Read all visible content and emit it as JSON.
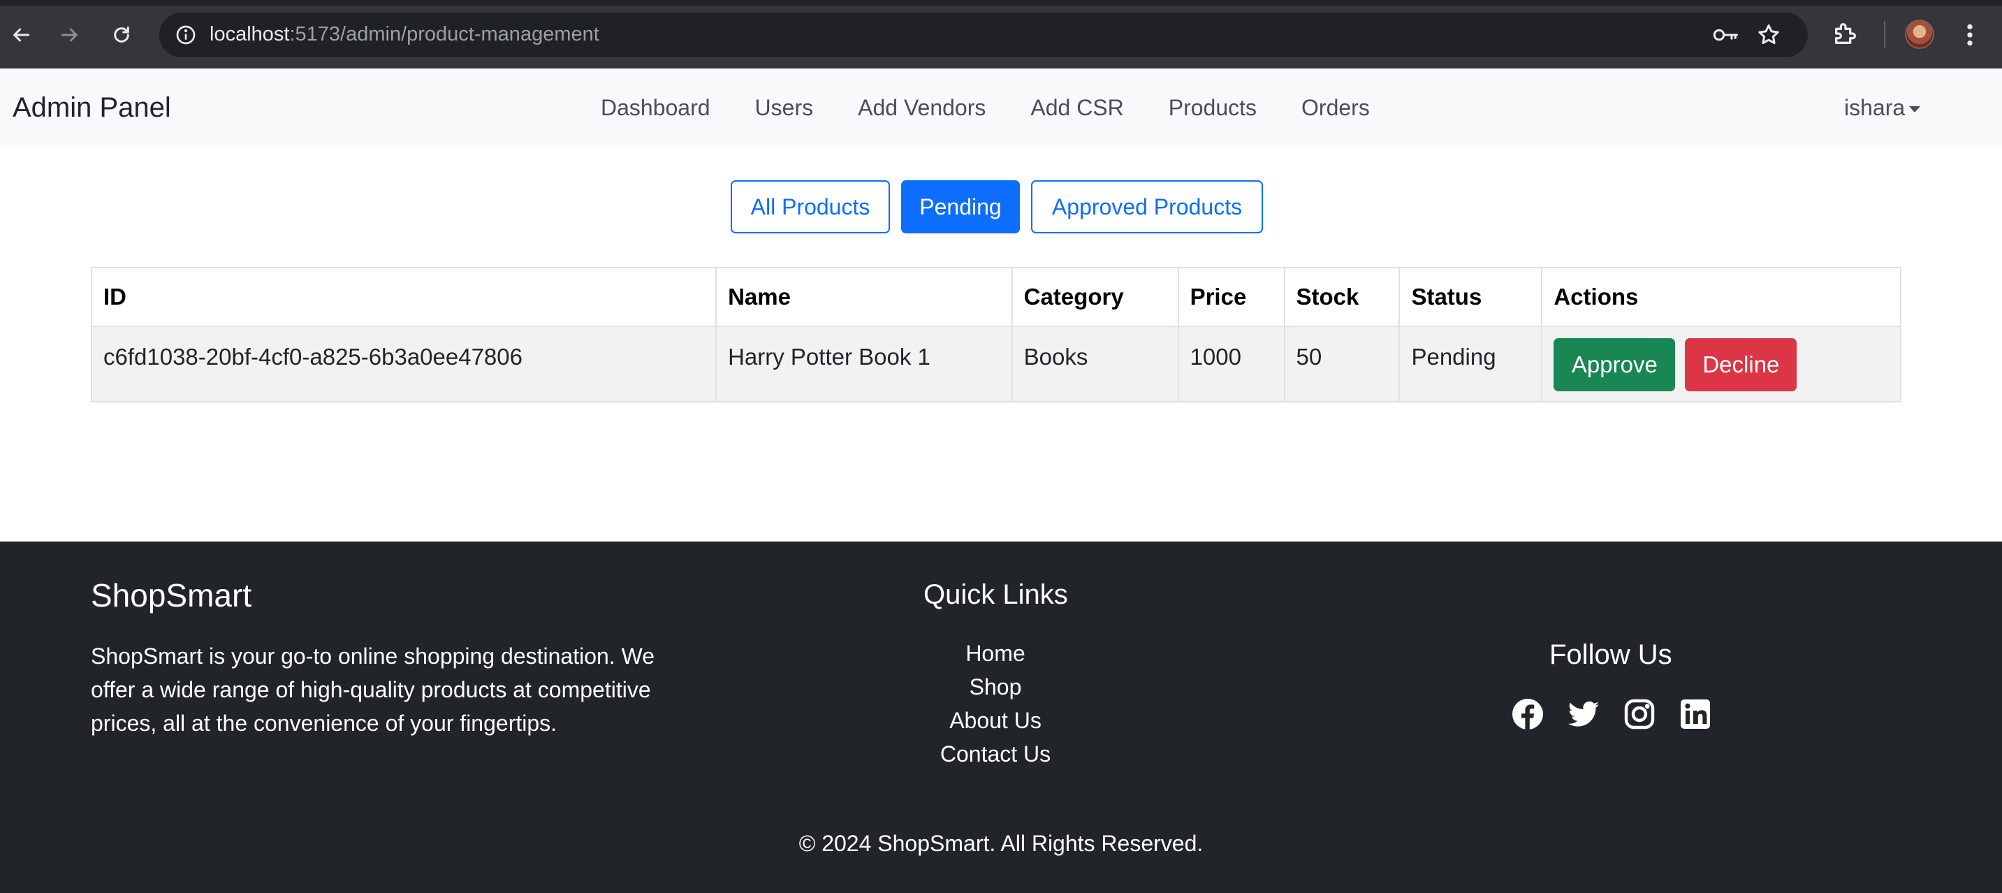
{
  "browser": {
    "url_host": "localhost",
    "url_path": ":5173/admin/product-management"
  },
  "navbar": {
    "brand": "Admin Panel",
    "links": [
      "Dashboard",
      "Users",
      "Add Vendors",
      "Add CSR",
      "Products",
      "Orders"
    ],
    "user": "ishara"
  },
  "filters": {
    "all": "All Products",
    "pending": "Pending",
    "approved": "Approved Products",
    "active": "Pending"
  },
  "table": {
    "headers": [
      "ID",
      "Name",
      "Category",
      "Price",
      "Stock",
      "Status",
      "Actions"
    ],
    "rows": [
      {
        "id": "c6fd1038-20bf-4cf0-a825-6b3a0ee47806",
        "name": "Harry Potter Book 1",
        "category": "Books",
        "price": "1000",
        "stock": "50",
        "status": "Pending",
        "approve_label": "Approve",
        "decline_label": "Decline"
      }
    ]
  },
  "footer": {
    "brand": "ShopSmart",
    "description": "ShopSmart is your go-to online shopping destination. We offer a wide range of high-quality products at competitive prices, all at the convenience of your fingertips.",
    "quick_links_title": "Quick Links",
    "quick_links": [
      "Home",
      "Shop",
      "About Us",
      "Contact Us"
    ],
    "follow_title": "Follow Us",
    "socials": [
      "facebook-icon",
      "twitter-icon",
      "instagram-icon",
      "linkedin-icon"
    ],
    "copyright": "© 2024 ShopSmart. All Rights Reserved."
  },
  "colors": {
    "primary": "#0d6efd",
    "success": "#198754",
    "danger": "#dc3545",
    "footer_bg": "#212529",
    "navbar_bg": "#f8f9fa"
  }
}
